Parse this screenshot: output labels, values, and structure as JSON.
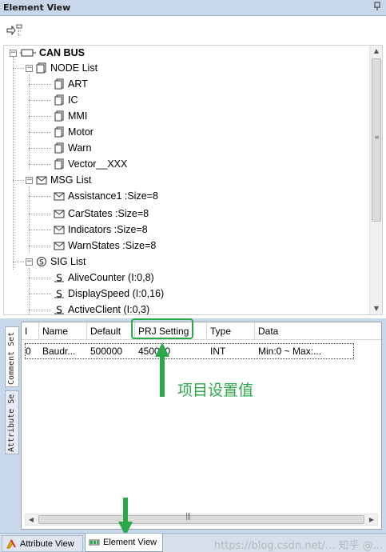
{
  "window": {
    "title": "Element View",
    "pin_icon": "pin-icon"
  },
  "toolbar": {
    "tree_view_icon": "tree-view-icon"
  },
  "tree": {
    "root": {
      "label": "CAN BUS",
      "icon": "bus-icon",
      "expander": "−"
    },
    "node_list": {
      "label": "NODE List",
      "icon": "node-list-icon",
      "expander": "−",
      "items": [
        "ART",
        "IC",
        "MMI",
        "Motor",
        "Warn",
        "Vector__XXX"
      ]
    },
    "msg_list": {
      "label": "MSG List",
      "icon": "envelope-icon",
      "expander": "−",
      "items": [
        "Assistance1  :Size=8",
        "CarStates  :Size=8",
        "Indicators  :Size=8",
        "WarnStates  :Size=8"
      ]
    },
    "sig_list": {
      "label": "SIG List",
      "icon": "signal-icon",
      "expander": "−",
      "items": [
        "AliveCounter (I:0,8)",
        "DisplaySpeed (I:0,16)",
        "ActiveClient (I:0,3)"
      ]
    }
  },
  "side_tabs": [
    "Comment Set",
    "Attribute Se"
  ],
  "grid": {
    "columns": [
      "I",
      "Name",
      "Default",
      "PRJ Setting",
      "Type",
      "Data"
    ],
    "rows": [
      [
        "0",
        "Baudr...",
        "500000",
        "450000",
        "INT",
        "Min:0 ~ Max:..."
      ]
    ]
  },
  "annotation": {
    "label": "项目设置值",
    "color": "#2aa84a"
  },
  "bottom_tabs": [
    {
      "label": "Attribute View",
      "icon": "attribute-view-icon",
      "active": false
    },
    {
      "label": "Element View",
      "icon": "element-view-icon",
      "active": true
    }
  ],
  "watermark": "https://blog.csdn.net/... 知乎 @...",
  "colors": {
    "titlebar": "#c9d7ea",
    "accent_green": "#2aa84a"
  }
}
